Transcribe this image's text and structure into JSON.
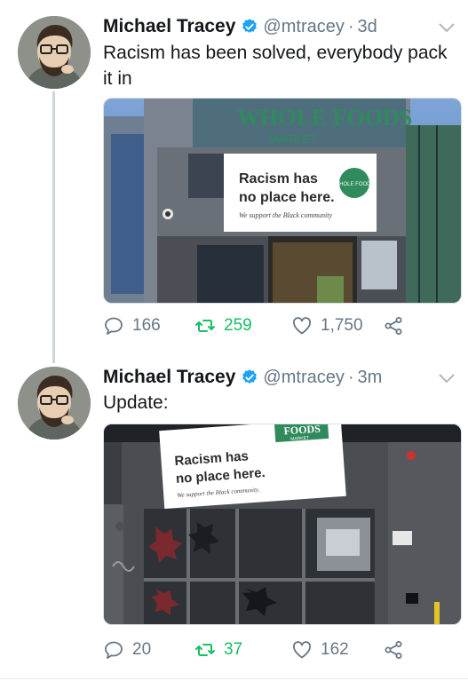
{
  "tweets": [
    {
      "name": "Michael Tracey",
      "handle": "@mtracey",
      "separator": "·",
      "time": "3d",
      "text": "Racism has been solved, everybody pack it in",
      "media": {
        "storefront_sign": "WHOLE FOODS",
        "storefront_sign_sub": "MARKET",
        "banner_headline": "Racism has no place here.",
        "banner_tagline": "We support the Black community",
        "banner_logo": "WHOLE FOODS"
      },
      "actions": {
        "replies": "166",
        "retweets": "259",
        "likes": "1,750"
      }
    },
    {
      "name": "Michael Tracey",
      "handle": "@mtracey",
      "separator": "·",
      "time": "3m",
      "text": "Update:",
      "media": {
        "storefront_sign": "FOODS",
        "storefront_sign_sub": "MARKET",
        "banner_headline": "Racism has no place here.",
        "banner_tagline": "We support the Black community."
      },
      "actions": {
        "replies": "20",
        "retweets": "37",
        "likes": "162"
      }
    }
  ],
  "colors": {
    "name_text": "#14171a",
    "meta_text": "#657786",
    "verified_blue": "#1da1f2",
    "retweet_green": "#17bf63",
    "thread_line": "#ccd6dd"
  },
  "icons": [
    "verified-badge-icon",
    "chevron-down-icon",
    "reply-icon",
    "retweet-icon",
    "like-icon",
    "share-icon"
  ]
}
